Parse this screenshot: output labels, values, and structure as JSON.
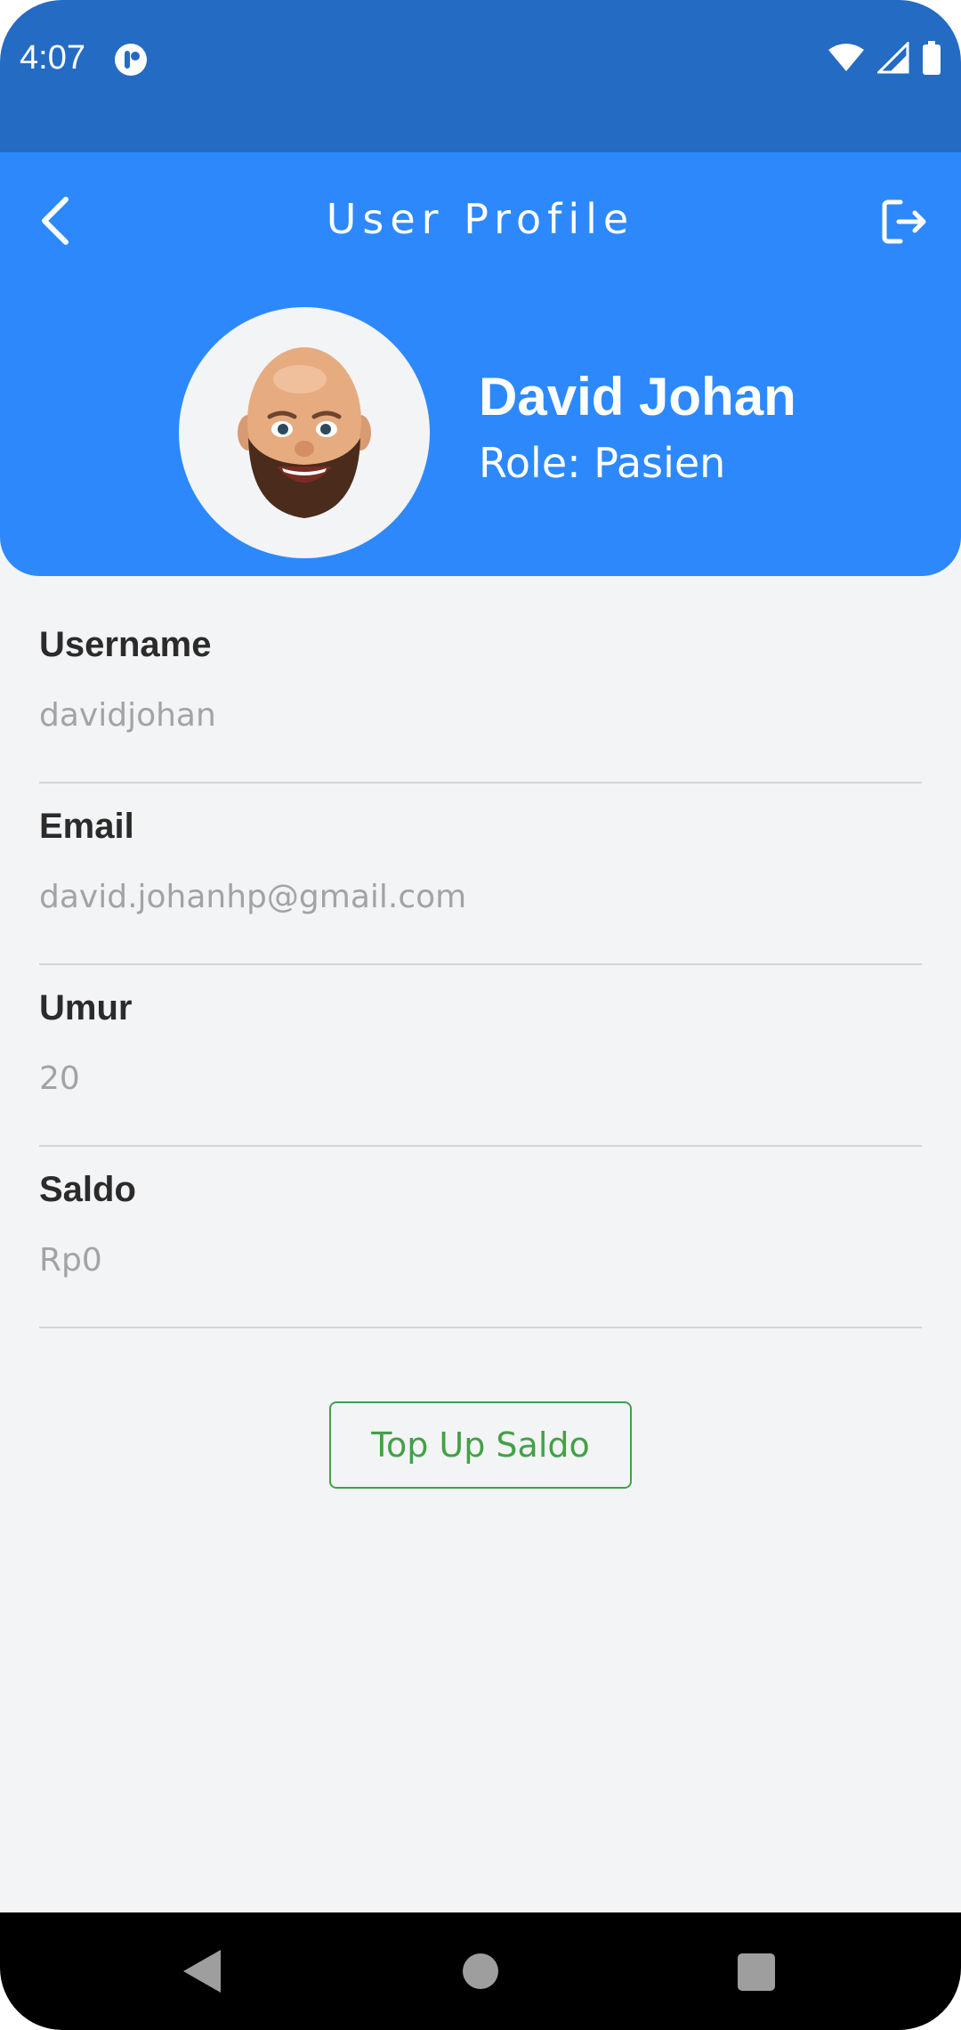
{
  "status_bar": {
    "time": "4:07",
    "background_color": "#246bc4",
    "icons": [
      "app-notification-icon",
      "wifi-icon",
      "cellular-signal-icon",
      "battery-icon"
    ]
  },
  "header": {
    "title": "User Profile",
    "background_color": "#2d89fb",
    "back_icon": "chevron-left-icon",
    "logout_icon": "logout-icon"
  },
  "profile": {
    "name": "David Johan",
    "role": "Role: Pasien",
    "avatar_icon": "memoji-avatar-icon"
  },
  "fields": [
    {
      "label": "Username",
      "value": "davidjohan"
    },
    {
      "label": "Email",
      "value": "david.johanhp@gmail.com"
    },
    {
      "label": "Umur",
      "value": "20"
    },
    {
      "label": "Saldo",
      "value": "Rp0"
    }
  ],
  "actions": {
    "topup_label": "Top Up Saldo",
    "topup_color": "#43a047"
  },
  "nav_bar": {
    "icons": [
      "nav-back-icon",
      "nav-home-icon",
      "nav-recents-icon"
    ]
  }
}
